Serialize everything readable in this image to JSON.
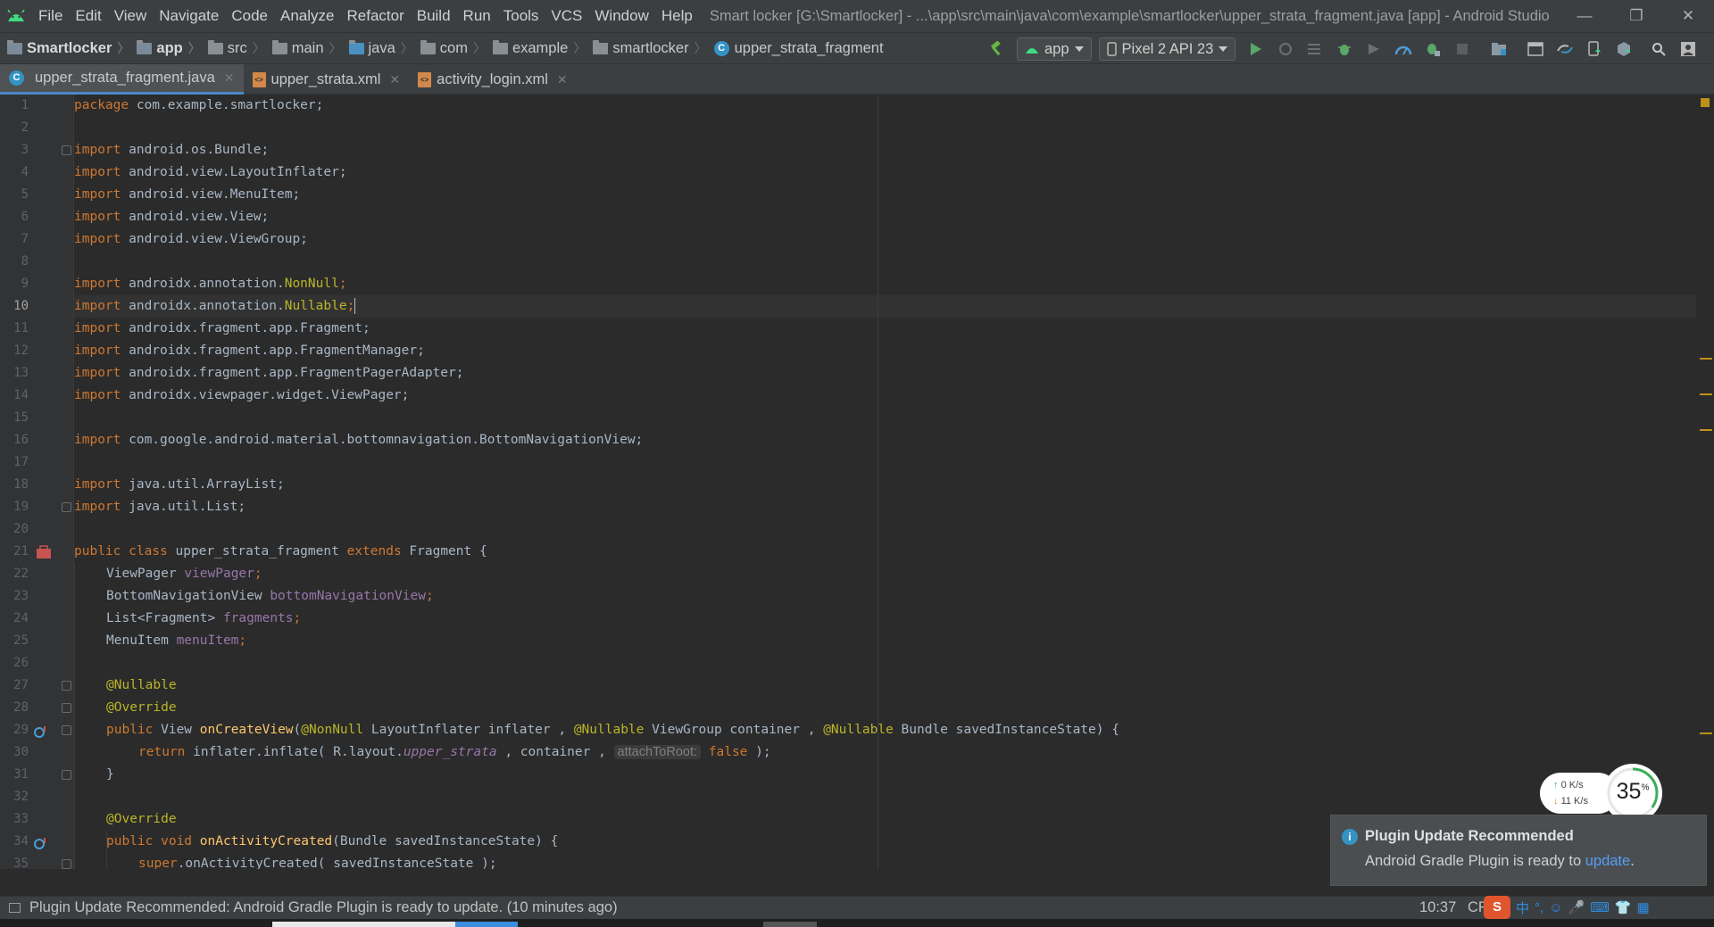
{
  "menubar": {
    "items": [
      "File",
      "Edit",
      "View",
      "Navigate",
      "Code",
      "Analyze",
      "Refactor",
      "Build",
      "Run",
      "Tools",
      "VCS",
      "Window",
      "Help"
    ],
    "title": "Smart locker [G:\\Smartlocker] - ...\\app\\src\\main\\java\\com\\example\\smartlocker\\upper_strata_fragment.java [app] - Android Studio",
    "minimize": "—",
    "restore": "❐",
    "close": "✕"
  },
  "breadcrumbs": [
    "Smartlocker",
    "app",
    "src",
    "main",
    "java",
    "com",
    "example",
    "smartlocker",
    "upper_strata_fragment"
  ],
  "toolbar": {
    "run_config": "app",
    "device": "Pixel 2 API 23"
  },
  "tabs": [
    {
      "label": "upper_strata_fragment.java",
      "type": "java",
      "active": true
    },
    {
      "label": "upper_strata.xml",
      "type": "xml",
      "active": false
    },
    {
      "label": "activity_login.xml",
      "type": "xml",
      "active": false
    }
  ],
  "editor": {
    "current_line": 10,
    "line_numbers": [
      "1",
      "2",
      "3",
      "4",
      "5",
      "6",
      "7",
      "8",
      "9",
      "10",
      "11",
      "12",
      "13",
      "14",
      "15",
      "16",
      "17",
      "18",
      "19",
      "20",
      "21",
      "22",
      "23",
      "24",
      "25",
      "26",
      "27",
      "28",
      "29",
      "30",
      "31",
      "32",
      "33",
      "34",
      "35"
    ],
    "lines": {
      "l1": {
        "kw": "package",
        "rest": " com.example.smartlocker;"
      },
      "l3": {
        "kw": "import",
        "rest": " android.os.Bundle;"
      },
      "l4": {
        "kw": "import",
        "rest": " android.view.LayoutInflater;"
      },
      "l5": {
        "kw": "import",
        "rest": " android.view.MenuItem;"
      },
      "l6": {
        "kw": "import",
        "rest": " android.view.View;"
      },
      "l7": {
        "kw": "import",
        "rest": " android.view.ViewGroup;"
      },
      "l9": {
        "kw": "import",
        "pre": " androidx.annotation.",
        "ann": "NonNull",
        "end": ";"
      },
      "l10": {
        "kw": "import",
        "pre": " androidx.annotation.",
        "ann": "Nullable",
        "end": ";"
      },
      "l11": {
        "kw": "import",
        "rest": " androidx.fragment.app.Fragment;"
      },
      "l12": {
        "kw": "import",
        "rest": " androidx.fragment.app.FragmentManager;"
      },
      "l13": {
        "kw": "import",
        "rest": " androidx.fragment.app.FragmentPagerAdapter;"
      },
      "l14": {
        "kw": "import",
        "rest": " androidx.viewpager.widget.ViewPager;"
      },
      "l16": {
        "kw": "import",
        "rest": " com.google.android.material.bottomnavigation.BottomNavigationView;"
      },
      "l18": {
        "kw": "import",
        "rest": " java.util.ArrayList;"
      },
      "l19": {
        "kw": "import",
        "rest": " java.util.List;"
      },
      "l21": {
        "kw1": "public class",
        "name": " upper_strata_fragment ",
        "kw2": "extends",
        "rest": " Fragment {"
      },
      "l22": {
        "type": "ViewPager ",
        "field": "viewPager",
        "end": ";"
      },
      "l23": {
        "type": "BottomNavigationView ",
        "field": "bottomNavigationView",
        "end": ";"
      },
      "l24": {
        "type": "List<Fragment> ",
        "field": "fragments",
        "end": ";"
      },
      "l25": {
        "type": "MenuItem ",
        "field": "menuItem",
        "end": ";"
      },
      "l27": {
        "ann": "@Nullable"
      },
      "l28": {
        "ann": "@Override"
      },
      "l29": {
        "kw": "public",
        "type": " View ",
        "fn": "onCreateView",
        "p1": "(",
        "a1": "@NonNull",
        "t1": " LayoutInflater inflater , ",
        "a2": "@Nullable",
        "t2": " ViewGroup container , ",
        "a3": "@Nullable",
        "t3": " Bundle savedInstanceState) {"
      },
      "l30": {
        "kw": "return",
        "pre": " inflater.inflate( R.layout.",
        "ital": "upper_strata",
        "mid": " , container , ",
        "hint": "attachToRoot:",
        "kw2": " false",
        "end": " );"
      },
      "l31": {
        "rest": "}"
      },
      "l33": {
        "ann": "@Override"
      },
      "l34": {
        "kw": "public void",
        "fn": " onActivityCreated",
        "rest": "(Bundle savedInstanceState) {"
      },
      "l35": {
        "kw": "super",
        "rest": ".onActivityCreated( savedInstanceState );"
      }
    }
  },
  "notification": {
    "title": "Plugin Update Recommended",
    "body": "Android Gradle Plugin is ready to ",
    "link": "update",
    "end": "."
  },
  "statusbar": {
    "message": "Plugin Update Recommended: Android Gradle Plugin is ready to update. (10 minutes ago)",
    "time": "10:37",
    "line_sep": "CR"
  },
  "netwidget": {
    "up": "0",
    "down": "11",
    "unit": "K/s",
    "percent": "35",
    "percent_sign": "%"
  },
  "colors": {
    "background": "#2b2b2b",
    "keyword": "#cc7832",
    "annotation": "#bbb529",
    "field": "#9876aa",
    "method": "#ffc66d",
    "text": "#a9b7c6"
  }
}
